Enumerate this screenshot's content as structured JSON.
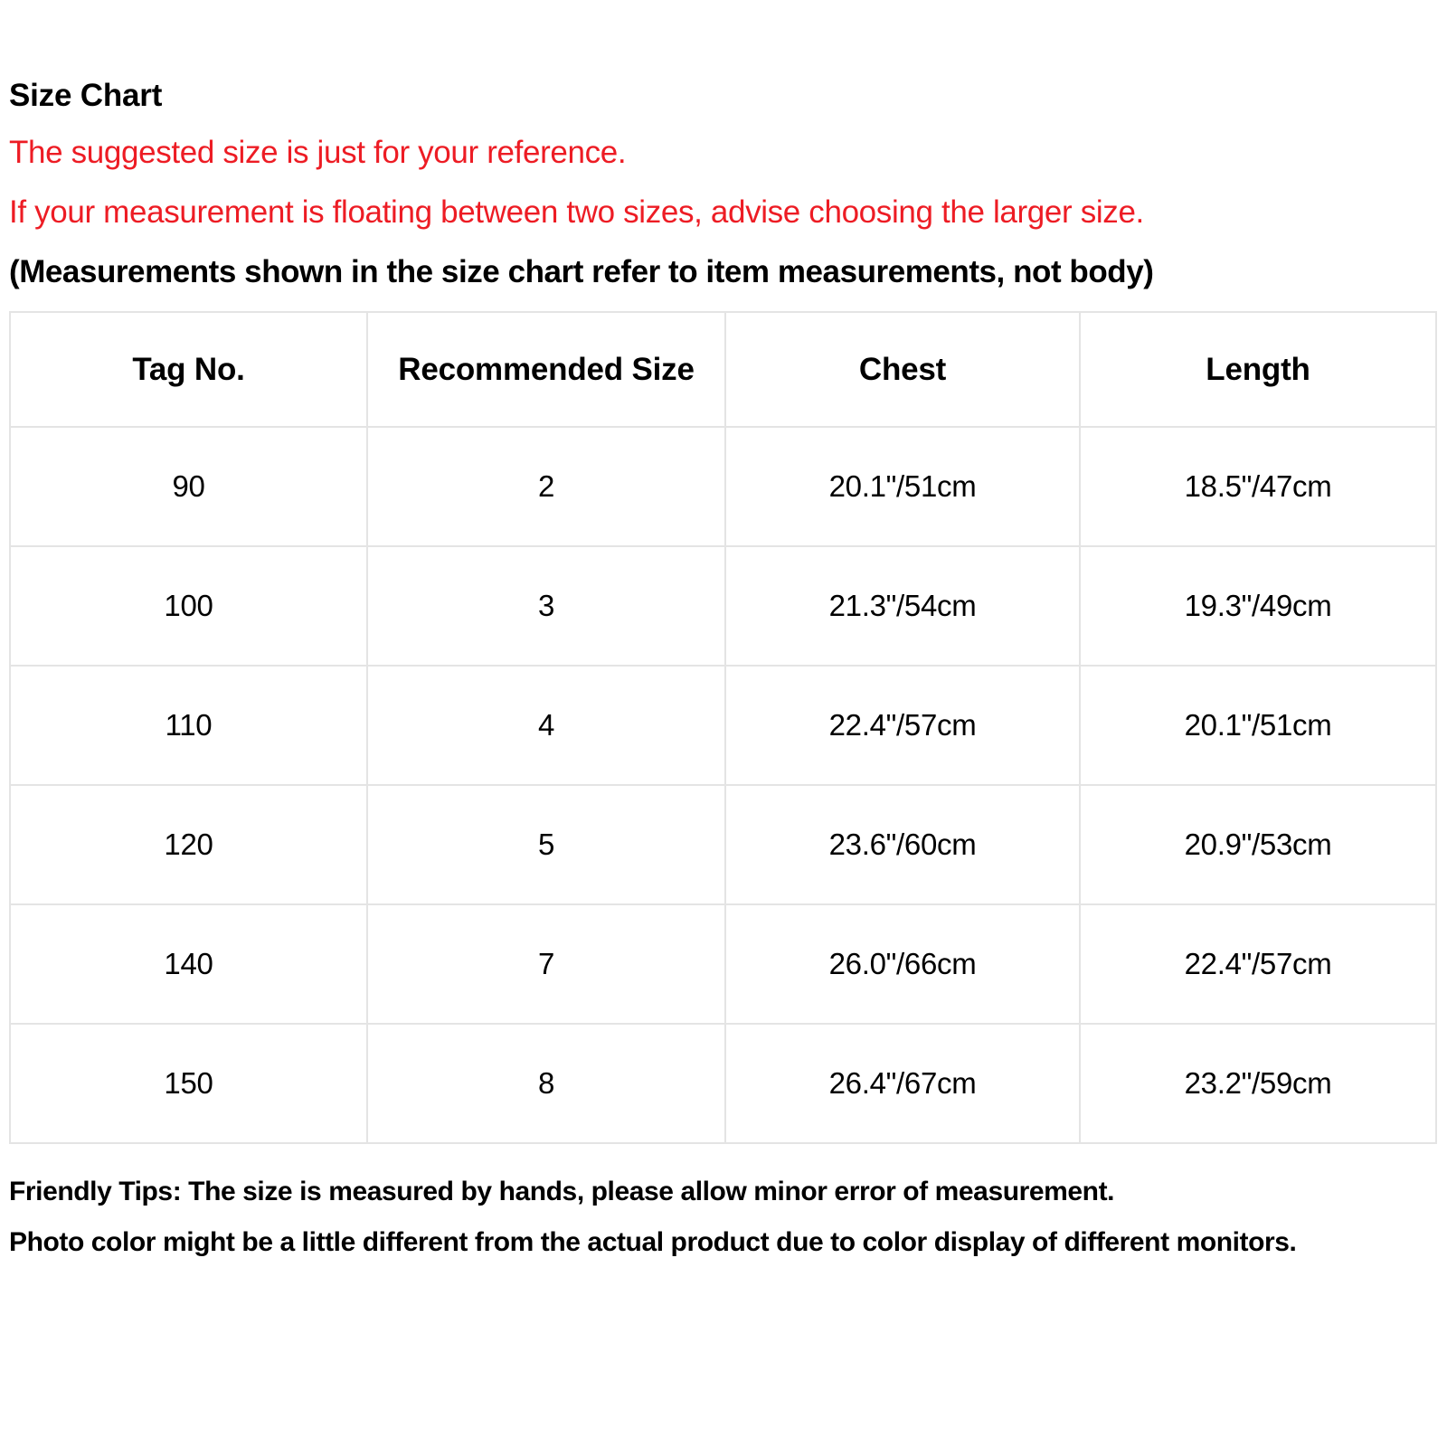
{
  "document": {
    "title": "Size Chart",
    "notes": [
      {
        "text": "The suggested size is just for your reference.",
        "color": "#ed1c24",
        "bold": false
      },
      {
        "text": "If your measurement is floating between two sizes, advise choosing the larger size.",
        "color": "#ed1c24",
        "bold": false
      },
      {
        "text": "(Measurements shown in the size chart refer to item measurements, not body)",
        "color": "#000000",
        "bold": true
      }
    ],
    "footer_notes": [
      "Friendly Tips: The size is measured by hands, please allow minor error of measurement.",
      "Photo color might be a little different from the actual product due to color display of different monitors."
    ]
  },
  "colors": {
    "accent_red": "#ed1c24",
    "text_black": "#000000",
    "table_border": "#e4e4e4",
    "background": "#ffffff"
  },
  "chart_data": {
    "type": "table",
    "title": "Size Chart",
    "columns": [
      "Tag No.",
      "Recommended Size",
      "Chest",
      "Length"
    ],
    "rows": [
      [
        "90",
        "2",
        "20.1\"/51cm",
        "18.5\"/47cm"
      ],
      [
        "100",
        "3",
        "21.3\"/54cm",
        "19.3\"/49cm"
      ],
      [
        "110",
        "4",
        "22.4\"/57cm",
        "20.1\"/51cm"
      ],
      [
        "120",
        "5",
        "23.6\"/60cm",
        "20.9\"/53cm"
      ],
      [
        "140",
        "7",
        "26.0\"/66cm",
        "22.4\"/57cm"
      ],
      [
        "150",
        "8",
        "26.4\"/67cm",
        "23.2\"/59cm"
      ]
    ]
  }
}
